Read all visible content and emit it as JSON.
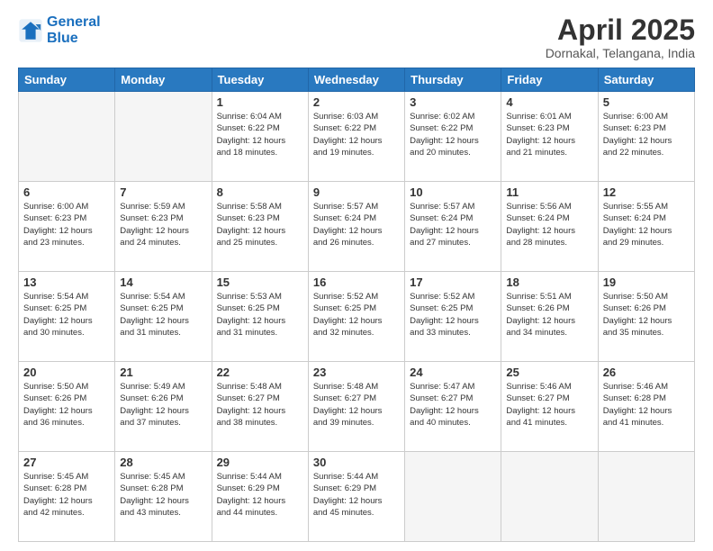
{
  "header": {
    "logo_general": "General",
    "logo_blue": "Blue",
    "title": "April 2025",
    "subtitle": "Dornakal, Telangana, India"
  },
  "days_of_week": [
    "Sunday",
    "Monday",
    "Tuesday",
    "Wednesday",
    "Thursday",
    "Friday",
    "Saturday"
  ],
  "weeks": [
    [
      {
        "day": "",
        "empty": true
      },
      {
        "day": "",
        "empty": true
      },
      {
        "day": "1",
        "sunrise": "6:04 AM",
        "sunset": "6:22 PM",
        "daylight": "12 hours and 18 minutes."
      },
      {
        "day": "2",
        "sunrise": "6:03 AM",
        "sunset": "6:22 PM",
        "daylight": "12 hours and 19 minutes."
      },
      {
        "day": "3",
        "sunrise": "6:02 AM",
        "sunset": "6:22 PM",
        "daylight": "12 hours and 20 minutes."
      },
      {
        "day": "4",
        "sunrise": "6:01 AM",
        "sunset": "6:23 PM",
        "daylight": "12 hours and 21 minutes."
      },
      {
        "day": "5",
        "sunrise": "6:00 AM",
        "sunset": "6:23 PM",
        "daylight": "12 hours and 22 minutes."
      }
    ],
    [
      {
        "day": "6",
        "sunrise": "6:00 AM",
        "sunset": "6:23 PM",
        "daylight": "12 hours and 23 minutes."
      },
      {
        "day": "7",
        "sunrise": "5:59 AM",
        "sunset": "6:23 PM",
        "daylight": "12 hours and 24 minutes."
      },
      {
        "day": "8",
        "sunrise": "5:58 AM",
        "sunset": "6:23 PM",
        "daylight": "12 hours and 25 minutes."
      },
      {
        "day": "9",
        "sunrise": "5:57 AM",
        "sunset": "6:24 PM",
        "daylight": "12 hours and 26 minutes."
      },
      {
        "day": "10",
        "sunrise": "5:57 AM",
        "sunset": "6:24 PM",
        "daylight": "12 hours and 27 minutes."
      },
      {
        "day": "11",
        "sunrise": "5:56 AM",
        "sunset": "6:24 PM",
        "daylight": "12 hours and 28 minutes."
      },
      {
        "day": "12",
        "sunrise": "5:55 AM",
        "sunset": "6:24 PM",
        "daylight": "12 hours and 29 minutes."
      }
    ],
    [
      {
        "day": "13",
        "sunrise": "5:54 AM",
        "sunset": "6:25 PM",
        "daylight": "12 hours and 30 minutes."
      },
      {
        "day": "14",
        "sunrise": "5:54 AM",
        "sunset": "6:25 PM",
        "daylight": "12 hours and 31 minutes."
      },
      {
        "day": "15",
        "sunrise": "5:53 AM",
        "sunset": "6:25 PM",
        "daylight": "12 hours and 31 minutes."
      },
      {
        "day": "16",
        "sunrise": "5:52 AM",
        "sunset": "6:25 PM",
        "daylight": "12 hours and 32 minutes."
      },
      {
        "day": "17",
        "sunrise": "5:52 AM",
        "sunset": "6:25 PM",
        "daylight": "12 hours and 33 minutes."
      },
      {
        "day": "18",
        "sunrise": "5:51 AM",
        "sunset": "6:26 PM",
        "daylight": "12 hours and 34 minutes."
      },
      {
        "day": "19",
        "sunrise": "5:50 AM",
        "sunset": "6:26 PM",
        "daylight": "12 hours and 35 minutes."
      }
    ],
    [
      {
        "day": "20",
        "sunrise": "5:50 AM",
        "sunset": "6:26 PM",
        "daylight": "12 hours and 36 minutes."
      },
      {
        "day": "21",
        "sunrise": "5:49 AM",
        "sunset": "6:26 PM",
        "daylight": "12 hours and 37 minutes."
      },
      {
        "day": "22",
        "sunrise": "5:48 AM",
        "sunset": "6:27 PM",
        "daylight": "12 hours and 38 minutes."
      },
      {
        "day": "23",
        "sunrise": "5:48 AM",
        "sunset": "6:27 PM",
        "daylight": "12 hours and 39 minutes."
      },
      {
        "day": "24",
        "sunrise": "5:47 AM",
        "sunset": "6:27 PM",
        "daylight": "12 hours and 40 minutes."
      },
      {
        "day": "25",
        "sunrise": "5:46 AM",
        "sunset": "6:27 PM",
        "daylight": "12 hours and 41 minutes."
      },
      {
        "day": "26",
        "sunrise": "5:46 AM",
        "sunset": "6:28 PM",
        "daylight": "12 hours and 41 minutes."
      }
    ],
    [
      {
        "day": "27",
        "sunrise": "5:45 AM",
        "sunset": "6:28 PM",
        "daylight": "12 hours and 42 minutes."
      },
      {
        "day": "28",
        "sunrise": "5:45 AM",
        "sunset": "6:28 PM",
        "daylight": "12 hours and 43 minutes."
      },
      {
        "day": "29",
        "sunrise": "5:44 AM",
        "sunset": "6:29 PM",
        "daylight": "12 hours and 44 minutes."
      },
      {
        "day": "30",
        "sunrise": "5:44 AM",
        "sunset": "6:29 PM",
        "daylight": "12 hours and 45 minutes."
      },
      {
        "day": "",
        "empty": true
      },
      {
        "day": "",
        "empty": true
      },
      {
        "day": "",
        "empty": true
      }
    ]
  ]
}
